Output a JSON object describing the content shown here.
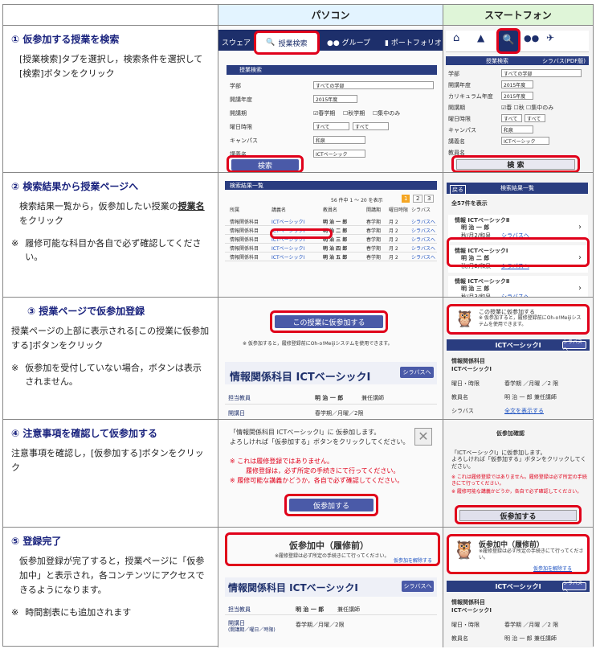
{
  "header": {
    "pc": "パソコン",
    "sp": "スマートフォン"
  },
  "steps": [
    {
      "title": "① 仮参加する授業を検索",
      "desc": "[授業検索]タブを選択し，検索条件を選択して[検索]ボタンをクリック",
      "note": ""
    },
    {
      "title": "② 検索結果から授業ページへ",
      "desc_a": "検索結果一覧から，仮参加したい授業の",
      "desc_b": "授業名",
      "desc_c": "をクリック",
      "note": "履修可能な科目か各自で必ず確認してください。"
    },
    {
      "title": "③ 授業ページで仮参加登録",
      "desc": "授業ページの上部に表示される[この授業に仮参加する]ボタンをクリック",
      "note": "仮参加を受付していない場合，ボタンは表示されません。"
    },
    {
      "title": "④ 注意事項を確認して仮参加する",
      "desc": "注意事項を確認し，[仮参加する]ボタンをクリック",
      "note": ""
    },
    {
      "title": "⑤ 登録完了",
      "desc": "仮参加登録が完了すると，授業ページに「仮参加中」と表示され，各コンテンツにアクセスできるようになります。",
      "note": "時間割表にも追加されます"
    }
  ],
  "note_mark": "※",
  "pc1": {
    "tab_left": "スウェア",
    "tab_search": "授業検索",
    "tab_group": "グループ",
    "tab_portfolio": "ポートフォリオ",
    "panel": "授業検索",
    "rows": [
      [
        "学部",
        "すべての学部"
      ],
      [
        "開講年度",
        "2015年度"
      ],
      [
        "開講期",
        ""
      ],
      [
        "曜日時限",
        "すべて",
        "すべて"
      ],
      [
        "キャンパス",
        "和泉"
      ],
      [
        "講義名",
        "ICTベーシック"
      ]
    ],
    "chk": [
      "春学期",
      "秋学期",
      "集中のみ"
    ],
    "search_btn": "検索"
  },
  "sp1": {
    "icons": [
      "HOME",
      "クラスウェア",
      "授業検索",
      "グループ",
      "グローバル"
    ],
    "bar": "授業検索",
    "syl": "シラバス(PDF版)",
    "rows": [
      [
        "学部",
        "すべての学部"
      ],
      [
        "開講年度",
        "2015年度"
      ],
      [
        "カリキュラム年度",
        "2015年度"
      ],
      [
        "開講期",
        ""
      ],
      [
        "曜日時限",
        "すべて",
        "すべて"
      ],
      [
        "キャンパス",
        "和泉"
      ],
      [
        "講義名",
        "ICTベーシック"
      ],
      [
        "教員名",
        ""
      ]
    ],
    "chk": [
      "春",
      "秋",
      "集中のみ"
    ],
    "search_btn": "検 索"
  },
  "pc2": {
    "bar": "検索結果一覧",
    "count": "56 件中 1 〜 20 を表示",
    "pages": [
      "1",
      "2",
      "3"
    ],
    "cols": [
      "所属",
      "講義名",
      "教員名",
      "開講期",
      "曜日時限",
      "シラバス"
    ],
    "rows": [
      [
        "情報関係科目",
        "ICTベーシックⅠ",
        "明 治 一 郎",
        "春学期",
        "月 2",
        "シラバスへ"
      ],
      [
        "情報関係科目",
        "ICTベーシックⅠ",
        "明 治 二 郎",
        "春学期",
        "月 2",
        "シラバスへ"
      ],
      [
        "情報関係科目",
        "ICTベーシックⅠ",
        "明 治 三 郎",
        "春学期",
        "月 2",
        "シラバスへ"
      ],
      [
        "情報関係科目",
        "ICTベーシックⅠ",
        "明 治 四 郎",
        "春学期",
        "月 2",
        "シラバスへ"
      ],
      [
        "情報関係科目",
        "ICTベーシックⅠ",
        "明 治 五 郎",
        "春学期",
        "月 2",
        "シラバスへ"
      ]
    ]
  },
  "sp2": {
    "back": "戻る",
    "bar": "検索結果一覧",
    "count": "全57件を表示",
    "items": [
      {
        "t": "情報 ICTベーシックⅡ",
        "n": "明 治 一 郎",
        "s": "秋/月2/和泉",
        "l": "シラバスへ"
      },
      {
        "t": "情報 ICTベーシックⅠ",
        "n": "明 治 二 郎",
        "s": "秋/月2/和泉",
        "l": "シラバスへ"
      },
      {
        "t": "情報 ICTベーシックⅡ",
        "n": "明 治 三 郎",
        "s": "秋/月3/和泉",
        "l": "シラバスへ"
      }
    ]
  },
  "pc3": {
    "btn": "この授業に仮参加する",
    "note": "※ 仮参加すると，履修登録前にOh-o!Meijiシステムを使用できます。",
    "course": "情報関係科目 ICTベーシックⅠ",
    "syl": "シラバスへ",
    "r1": "担当教員",
    "r1v": "明 治 一 郎",
    "r1s": "兼任講師",
    "r2": "開講日",
    "r2v": "春学期／月曜／2限"
  },
  "sp3": {
    "line1": "この授業に仮参加する",
    "line2": "※ 仮参加すると，履修登録前にOh-o!Meijiシステムを使用できます。",
    "course": "ICTベーシックⅠ",
    "syl": "シラバスへ",
    "k1": "情報関係科目",
    "k2": "ICTベーシックⅠ",
    "r": [
      [
        "曜日・時限",
        "春学期 ／月曜 ／2 限"
      ],
      [
        "教員名",
        "明 治 一 郎 兼任講師"
      ],
      [
        "シラバス",
        "全文を表示する"
      ]
    ]
  },
  "pc4": {
    "line1": "「情報関係科目 ICTベーシックⅠ」に 仮参加します。",
    "line2": "よろしければ「仮参加する」ボタンをクリックしてください。",
    "r1": "※ これは履修登録ではありません。",
    "r2": "履修登録は，必ず所定の手続きにて行ってください。",
    "r3": "※ 履修可能な講義かどうか，各自で必ず確認してください。",
    "btn": "仮参加する"
  },
  "sp4": {
    "bar": "仮参加確認",
    "line1": "「ICTベーシックⅠ」に仮参加します。",
    "line2": "よろしければ「仮参加する」ボタンをクリックしてください。",
    "r1": "※ これは履修登録ではありません。履修登録は必ず所定の手続きにて行ってください。",
    "r2": "※ 履修可能な講義かどうか，各自で必ず確認してください。",
    "btn": "仮参加する"
  },
  "pc5": {
    "title": "仮参加中（履修前）",
    "sub": "※履修登録は必ず所定の手続きにて行ってください。",
    "link": "仮参加を解除する",
    "course": "情報関係科目 ICTベーシックⅠ",
    "syl": "シラバスへ",
    "r1": "担当教員",
    "r1v": "明 治 一 郎",
    "r1s": "兼任講師",
    "r2": "開講日",
    "r2b": "(開講期／曜日／時限)",
    "r2v": "春学期／月曜／2限"
  },
  "sp5": {
    "title": "仮参加中（履修前）",
    "sub": "※履修登録は必ず所定の手続きにて行ってください。",
    "link": "仮参加を解除する",
    "course": "ICTベーシックⅠ",
    "syl": "シラバスへ",
    "k1": "情報関係科目",
    "k2": "ICTベーシックⅠ",
    "r": [
      [
        "曜日・時限",
        "春学期 ／月曜 ／2 限"
      ],
      [
        "教員名",
        "明 治 一 郎 兼任講師"
      ]
    ]
  }
}
